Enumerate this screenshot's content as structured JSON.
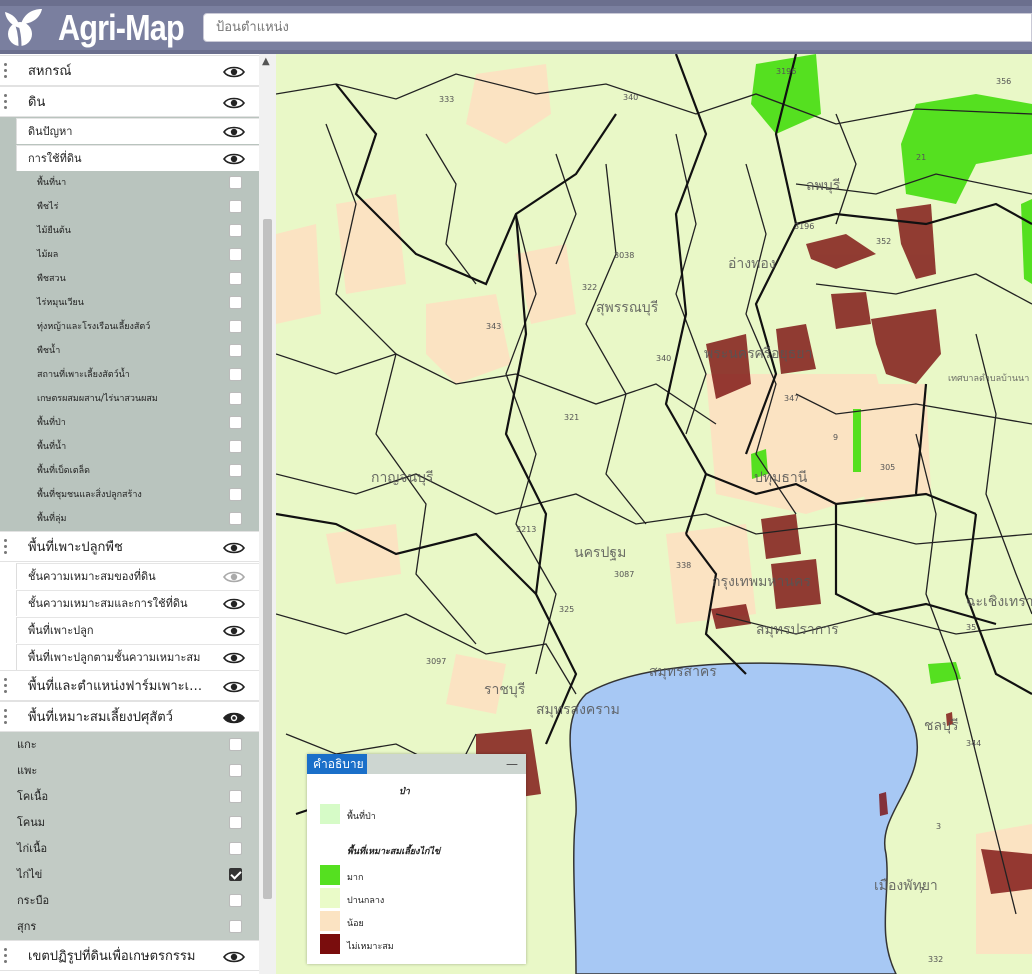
{
  "app": {
    "brand": "Agri-Map",
    "search_placeholder": "ป้อนตำแหน่ง"
  },
  "sidebar": {
    "group_cooperative": "สหกรณ์",
    "group_soil": "ดิน",
    "soil_sub": [
      "ดินปัญหา",
      "การใช้ที่ดิน"
    ],
    "landuse_items": [
      "พื้นที่นา",
      "พืชไร่",
      "ไม้ยืนต้น",
      "ไม้ผล",
      "พืชสวน",
      "ไร่หมุนเวียน",
      "ทุ่งหญ้าและโรงเรือนเลี้ยงสัตว์",
      "พืชน้ำ",
      "สถานที่เพาะเลี้ยงสัตว์น้ำ",
      "เกษตรผสมผสาน/ไร่นาสวนผสม",
      "พื้นที่ป่า",
      "พื้นที่น้ำ",
      "พื้นที่เบ็ดเตล็ด",
      "พื้นที่ชุมชนและสิ่งปลูกสร้าง",
      "พื้นที่ลุ่ม"
    ],
    "group_crop": "พื้นที่เพาะปลูกพืช",
    "crop_sub": [
      "ชั้นความเหมาะสมของที่ดิน",
      "ชั้นความเหมาะสมและการใช้ที่ดิน",
      "พื้นที่เพาะปลูก",
      "พื้นที่เพาะปลูกตามชั้นความเหมาะสม"
    ],
    "group_farm": "พื้นที่และตำแหน่งฟาร์มเพาะเลี้ยงสัตว์น้ำ",
    "group_livestock": "พื้นที่เหมาะสมเลี้ยงปศุสัตว์",
    "livestock_items": [
      "แกะ",
      "แพะ",
      "โคเนื้อ",
      "โคนม",
      "ไก่เนื้อ",
      "ไก่ไข่",
      "กระบือ",
      "สุกร"
    ],
    "livestock_checked": "ไก่ไข่",
    "group_reform": "เขตปฏิรูปที่ดินเพื่อเกษตรกรรม"
  },
  "legend": {
    "title": "คำอธิบาย",
    "minimize": "—",
    "section_forest": "ป่า",
    "forest_label": "พื้นที่ป่า",
    "section_suit": "พื้นที่เหมาะสมเลี้ยงไก่ไข่",
    "items": [
      {
        "label": "มาก",
        "color": "#55e020"
      },
      {
        "label": "ปานกลาง",
        "color": "#eafbc8"
      },
      {
        "label": "น้อย",
        "color": "#fbe3c2"
      },
      {
        "label": "ไม่เหมาะสม",
        "color": "#7a0d0d"
      }
    ],
    "forest_color": "#d6fbc7"
  },
  "map": {
    "province_labels": [
      "ลพบุรี",
      "สุพรรณบุรี",
      "พระนครศรีอยุธยา",
      "กาญจนบุรี",
      "นครปฐม",
      "ราชบุรี",
      "สมุทรสาคร",
      "สมุทรสงคราม",
      "ฉะเชิงเทรา",
      "ชลบุรี",
      "เมืองพัทยา",
      "สมุทรปราการ",
      "กรุงเทพมหานคร",
      "อ่างทอง",
      "ปทุมธานี",
      "เทศบาลตำบลบ้านนา"
    ],
    "road_numbers": [
      "3196",
      "333",
      "340",
      "356",
      "21",
      "3196",
      "3038",
      "322",
      "343",
      "340",
      "352",
      "347",
      "9",
      "305",
      "321",
      "3213",
      "325",
      "3087",
      "338",
      "3097",
      "346",
      "35",
      "344",
      "332",
      "7",
      "3"
    ],
    "colors": {
      "sea": "#a7c8f4",
      "base": "#e9f8c7",
      "low": "#fbe3c2",
      "high": "#55e020",
      "unsuitable": "#7a0d0d"
    }
  }
}
